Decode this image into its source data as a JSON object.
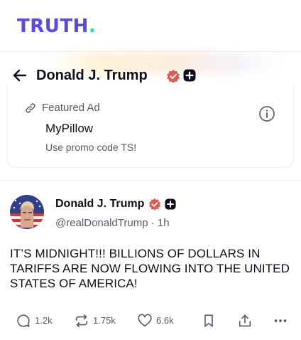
{
  "header": {
    "logo_text": "TRUTH",
    "logo_dot": ".",
    "logo_color": "#5448ee",
    "logo_dot_color": "#17e6b5"
  },
  "profile": {
    "name": "Donald J. Trump",
    "back_icon": "arrow-left-icon",
    "badges": [
      "verified-badge-icon",
      "plus-badge-icon"
    ]
  },
  "ad": {
    "label": "Featured Ad",
    "title": "MyPillow",
    "subtitle": "Use promo code TS!",
    "label_icon": "link-icon",
    "info_icon": "info-icon"
  },
  "post": {
    "author_name": "Donald J. Trump",
    "handle": "@realDonaldTrump",
    "separator": "·",
    "time": "1h",
    "text": "IT’S MIDNIGHT!!! BILLIONS OF DOLLARS IN TARIFFS ARE NOW FLOWING INTO THE UNITED STATES OF AMERICA!",
    "actions": {
      "replies": "1.2k",
      "retruths": "1.75k",
      "likes": "6.6k"
    }
  },
  "colors": {
    "verified": "#e05a52",
    "text_primary": "#0f0e1d",
    "text_secondary": "#5a5a6e",
    "divider": "#ececf1"
  }
}
